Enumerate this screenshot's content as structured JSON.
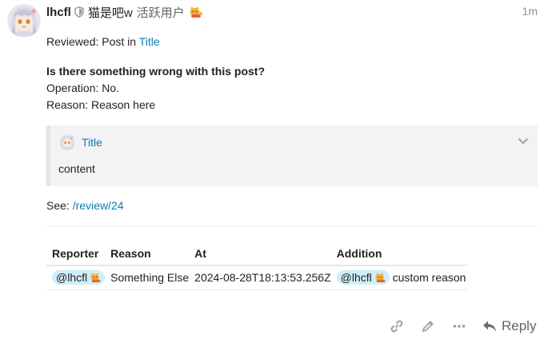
{
  "post": {
    "username": "lhcfl",
    "full_name": "猫是吧w",
    "user_title": "活跃用户",
    "time": "1m",
    "flair_icon": "cat-emoji-icon",
    "accent_color": "#0d7ab0"
  },
  "body": {
    "reviewed_prefix": "Reviewed: Post in",
    "reviewed_link": "Title",
    "question": "Is there something wrong with this post?",
    "operation": "Operation: No.",
    "reason": "Reason: Reason here",
    "quote": {
      "title": "Title",
      "content": "content"
    },
    "see_prefix": "See:",
    "see_link": "/review/24"
  },
  "table": {
    "headers": [
      "Reporter",
      "Reason",
      "At",
      "Addition"
    ],
    "row": {
      "reporter": "@lhcfl",
      "reason": "Something Else",
      "at": "2024-08-28T18:13:53.256Z",
      "addition_mention": "@lhcfl",
      "addition_text": "custom reason"
    }
  },
  "actions": {
    "reply_label": "Reply"
  }
}
